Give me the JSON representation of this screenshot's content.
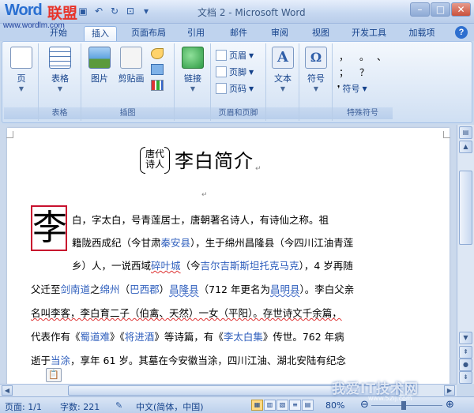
{
  "watermark": {
    "brand_word": "Word",
    "brand_lm": "联盟",
    "brand_url": "www.wordlm.com",
    "bottom_site": "我爱IT技术网",
    "bottom_site_url": "www.52ij.com"
  },
  "window": {
    "title": "文档 2 - Microsoft Word",
    "qat_icons": [
      "save-icon",
      "undo-icon",
      "redo-icon",
      "print-preview-icon",
      "dropdown-icon"
    ]
  },
  "tabs": [
    "开始",
    "插入",
    "页面布局",
    "引用",
    "邮件",
    "审阅",
    "视图",
    "开发工具",
    "加载项"
  ],
  "active_tab": "插入",
  "ribbon": {
    "groups": {
      "pages": {
        "button": "页"
      },
      "tables": {
        "button": "表格",
        "label": "表格"
      },
      "illustrations": {
        "picture": "图片",
        "clipart": "剪贴画",
        "label": "插图"
      },
      "links": {
        "button": "链接"
      },
      "header_footer": {
        "header": "页眉",
        "footer": "页脚",
        "page_number": "页码",
        "label": "页眉和页脚"
      },
      "text": {
        "button": "文本"
      },
      "symbols": {
        "button": "符号"
      },
      "special": {
        "symbol_btn": "符号",
        "label": "特殊符号",
        "glyphs": [
          "，",
          "。",
          "、",
          "；",
          "？"
        ]
      }
    }
  },
  "document": {
    "ruby_top": "唐代",
    "ruby_bottom": "诗人",
    "title": "李白简介",
    "para_mark": "↵",
    "dropcap": "李",
    "lines": {
      "l1": "白，字太白，号青莲居士，唐朝著名诗人，有诗仙之称。祖",
      "l2a": "籍陇西成纪（今甘肃",
      "l2b": "秦安县",
      "l2c": "），生于绵州昌隆县（今四川江油青莲",
      "l3a": "乡）人，一说西域",
      "l3b": "碎叶城",
      "l3c": "（今",
      "l3d": "吉尔吉斯斯坦托克马克",
      "l3e": "），4 岁再随",
      "l4a": "父迁至",
      "l4b": "剑南道",
      "l4c": "之",
      "l4d": "绵州",
      "l4e": "（",
      "l4f": "巴西郡",
      "l4g": "）",
      "l4h": "昌隆县",
      "l4i": "（712 年更名为",
      "l4j": "昌明县",
      "l4k": "）。李白父亲",
      "l5": "名叫李客，李白育二子（伯禽、天然）一女（平阳）。存世诗文千余篇，",
      "l6a": "代表作有《",
      "l6b": "蜀道难",
      "l6c": "》《",
      "l6d": "将进酒",
      "l6e": "》等诗篇，有《",
      "l6f": "李太白集",
      "l6g": "》传世。762 年病",
      "l7a": "逝于",
      "l7b": "当涂",
      "l7c": "，享年 61 岁。其墓在今安徽当涂，四川江油、湖北安陆有纪念"
    }
  },
  "status": {
    "page": "页面: 1/1",
    "words": "字数: 221",
    "language": "中文(简体，中国)",
    "zoom": "80%",
    "zoom_level_fraction": 0.45
  }
}
